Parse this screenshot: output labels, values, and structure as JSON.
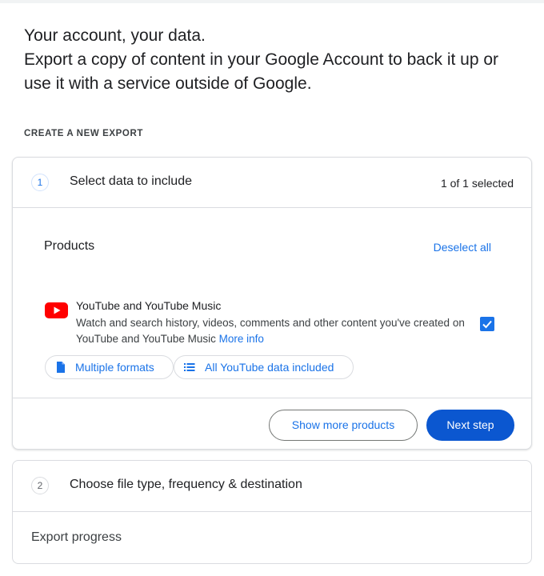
{
  "intro": {
    "line1": "Your account, your data.",
    "line2": "Export a copy of content in your Google Account to back it up or use it with a service outside of Google."
  },
  "section_label": "CREATE A NEW EXPORT",
  "step1": {
    "number": "1",
    "title": "Select data to include",
    "count": "1 of 1 selected",
    "products_label": "Products",
    "deselect_label": "Deselect all",
    "product": {
      "icon": "youtube-logo-icon",
      "name": "YouTube and YouTube Music",
      "description": "Watch and search history, videos, comments and other content you've created on YouTube and YouTube Music",
      "more_info": "More info",
      "checked": true
    },
    "chips": [
      {
        "label": "Multiple formats",
        "icon": "document-icon"
      },
      {
        "label": "All YouTube data included",
        "icon": "list-icon"
      }
    ],
    "buttons": {
      "show_more": "Show more products",
      "next": "Next step"
    }
  },
  "step2": {
    "number": "2",
    "title": "Choose file type, frequency & destination"
  },
  "export_progress": "Export progress",
  "colors": {
    "accent": "#1a73e8",
    "primary_button": "#0b57d0",
    "youtube_red": "#ff0000",
    "border": "#dadce0"
  }
}
